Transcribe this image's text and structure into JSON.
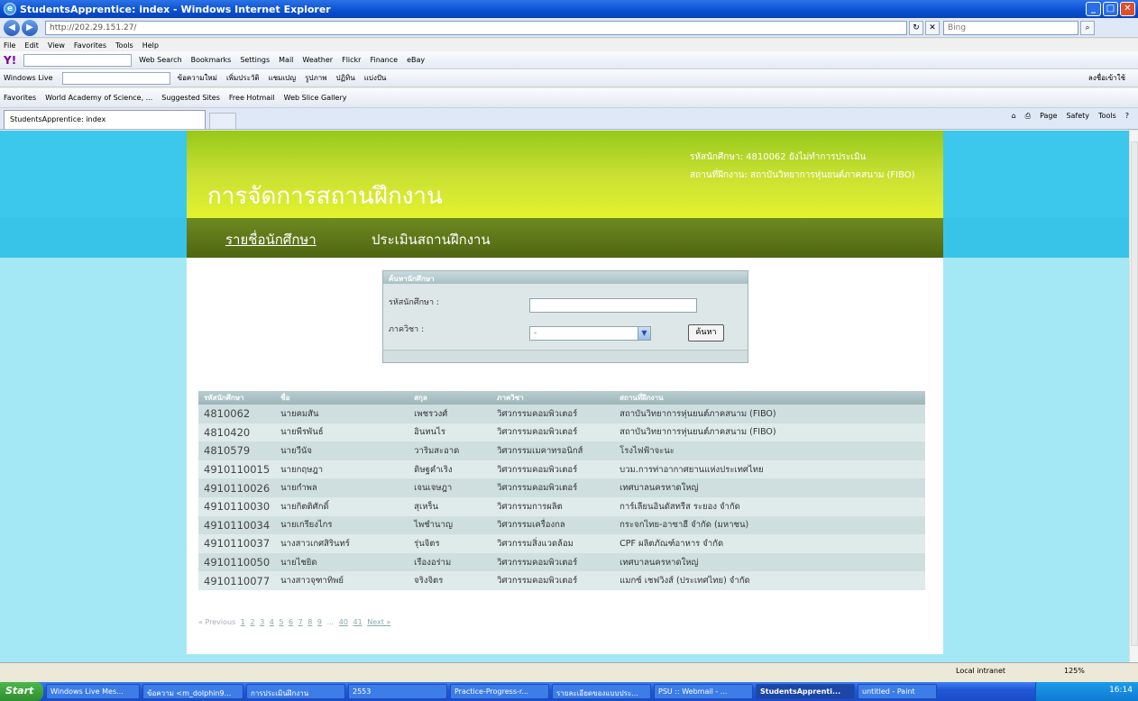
{
  "window": {
    "title": "StudentsApprentice: index - Windows Internet Explorer",
    "url": "http://202.29.151.27/",
    "search_placeholder": "Bing"
  },
  "menu": [
    "File",
    "Edit",
    "View",
    "Favorites",
    "Tools",
    "Help"
  ],
  "yahoo_toolbar": [
    "Web Search",
    "Bookmarks",
    "Settings",
    "Mail",
    "Weather",
    "Flickr",
    "Finance",
    "eBay"
  ],
  "live_toolbar": {
    "label": "Windows Live",
    "items": [
      "ข้อความใหม่",
      "เพิ่มประวัติ",
      "แชมเปญ",
      "รูปภาพ",
      "ปฏิทิน",
      "แบ่งปัน"
    ],
    "signin": "ลงชื่อเข้าใช้"
  },
  "favorites_bar": [
    "Favorites",
    "World Academy of Science, ...",
    "Suggested Sites",
    "Free Hotmail",
    "Web Slice Gallery"
  ],
  "tab": {
    "active": "StudentsApprentice: index"
  },
  "command_bar": [
    "Page",
    "Safety",
    "Tools"
  ],
  "header": {
    "site_title": "การจัดการสถานฝึกงาน",
    "user_line1": "รหัสนักศึกษา: 4810062 ยังไม่ทำการประเมิน",
    "user_line2": "สถานที่ฝึกงาน: สถาบันวิทยาการหุ่นยนต์ภาคสนาม (FIBO)"
  },
  "nav": {
    "students": "รายชื่อนักศึกษา",
    "evaluate": "ประเมินสถานฝึกงาน"
  },
  "search": {
    "title": "ค้นหานักศึกษา",
    "student_id_label": "รหัสนักศึกษา :",
    "department_label": "ภาควิชา :",
    "department_value": "-",
    "button": "ค้นหา"
  },
  "table": {
    "headers": [
      "รหัสนักศึกษา",
      "ชื่อ",
      "สกุล",
      "ภาควิชา",
      "สถานที่ฝึกงาน"
    ],
    "rows": [
      [
        "4810062",
        "นายคมสัน",
        "เพชรวงศ์",
        "วิศวกรรมคอมพิวเตอร์",
        "สถาบันวิทยาการหุ่นยนต์ภาคสนาม (FIBO)"
      ],
      [
        "4810420",
        "นายพีรพันธ์",
        "อินทนไร",
        "วิศวกรรมคอมพิวเตอร์",
        "สถาบันวิทยาการหุ่นยนต์ภาคสนาม (FIBO)"
      ],
      [
        "4810579",
        "นายวีนัจ",
        "วาริมสะอาด",
        "วิศวกรรมเมคาทรอนิกส์",
        "โรงไฟฟ้าจะนะ"
      ],
      [
        "4910110015",
        "นายกฤษฎา",
        "ดิษฐคำเริง",
        "วิศวกรรมคอมพิวเตอร์",
        "บวม.การท่าอากาศยานแห่งประเทศไทย"
      ],
      [
        "4910110026",
        "นายกำพล",
        "เจนเจษฎา",
        "วิศวกรรมคอมพิวเตอร์",
        "เทศบาลนครหาดใหญ่"
      ],
      [
        "4910110030",
        "นายกิตติศักดิ์",
        "สุเหร็น",
        "วิศวกรรมการผลิต",
        "การ์เลียนอินดัสทรีส ระยอง จำกัด"
      ],
      [
        "4910110034",
        "นายเกรียงไกร",
        "ไพชำนาญ",
        "วิศวกรรมเครื่องกล",
        "กระจกไทย-อาซาฮี จำกัด (มหาชน)"
      ],
      [
        "4910110037",
        "นางสาวเกศสิรินทร์",
        "รุ่นจิตร",
        "วิศวกรรมสิ่งแวดล้อม",
        "CPF ผลิตภัณฑ์อาหาร จำกัด"
      ],
      [
        "4910110050",
        "นายไชยิด",
        "เรืองอร่าม",
        "วิศวกรรมคอมพิวเตอร์",
        "เทศบาลนครหาดใหญ่"
      ],
      [
        "4910110077",
        "นางสาวจุฑาทิพย์",
        "จริงจิตร",
        "วิศวกรรมคอมพิวเตอร์",
        "แมกซ์ เชฟวิงส์ (ประเทศไทย) จำกัด"
      ]
    ]
  },
  "pager": {
    "prev": "« Previous",
    "pages": [
      "1",
      "2",
      "3",
      "4",
      "5",
      "6",
      "7",
      "8",
      "9",
      "...",
      "40",
      "41"
    ],
    "next": "Next »"
  },
  "status": {
    "zone": "Local intranet",
    "zoom": "125%"
  },
  "taskbar": {
    "start": "Start",
    "tasks": [
      "Windows Live Mes...",
      "ข้อความ <m_dolphin9...",
      "การประเมินฝึกงาน",
      "2553",
      "Practice-Progress-r...",
      "รายละเอียดของแบบประ...",
      "PSU :: Webmail - ...",
      "StudentsApprenti...",
      "untitled - Paint"
    ],
    "active_index": 7,
    "clock": "16:14"
  },
  "colors": {
    "page_bg": "#a3e8f4",
    "header_gradient_start": "#96c81a",
    "header_gradient_end": "#e4f230",
    "nav_dark": "#5a7318",
    "table_header": "#a8c0c4"
  }
}
